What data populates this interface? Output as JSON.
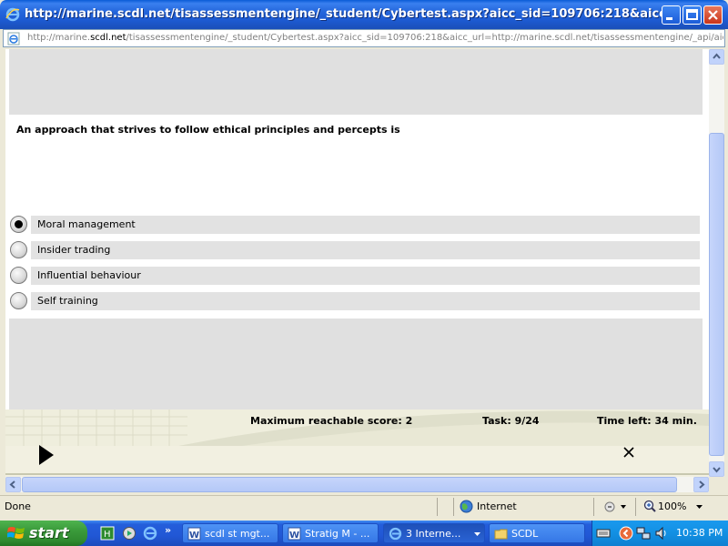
{
  "window": {
    "title": "http://marine.scdl.net/tisassessmentengine/_student/Cybertest.aspx?aicc_sid=109706:218&aicc_url - Windo..."
  },
  "address": {
    "url_prefix": "http://marine.",
    "url_host": "scdl.net",
    "url_rest": "/tisassessmentengine/_student/Cybertest.aspx?aicc_sid=109706:218&aicc_url=http://marine.scdl.net/tisassessmentengine/_api/aicc.a"
  },
  "quiz": {
    "question": "An approach that strives to follow ethical principles and percepts is",
    "options": [
      {
        "label": "Moral management",
        "selected": true
      },
      {
        "label": "Insider trading",
        "selected": false
      },
      {
        "label": "Influential behaviour",
        "selected": false
      },
      {
        "label": "Self training",
        "selected": false
      }
    ],
    "max_score": "Maximum reachable score: 2",
    "task": "Task: 9/24",
    "time_left": "Time left: 34 min."
  },
  "statusbar": {
    "status": "Done",
    "zone": "Internet",
    "zoom": "100%"
  },
  "taskbar": {
    "start_label": "start",
    "tasks": [
      {
        "label": "scdl st mgt...",
        "icon": "word-icon"
      },
      {
        "label": "Stratig  M - ...",
        "icon": "word-icon"
      },
      {
        "label": "3 Interne...",
        "icon": "ie-icon"
      },
      {
        "label": "SCDL",
        "icon": "folder-icon"
      }
    ],
    "clock": "10:38 PM"
  },
  "colors": {
    "title_blue": "#2466dc",
    "start_green": "#3a9a3a",
    "option_bar_gray": "#e2e2e2"
  }
}
